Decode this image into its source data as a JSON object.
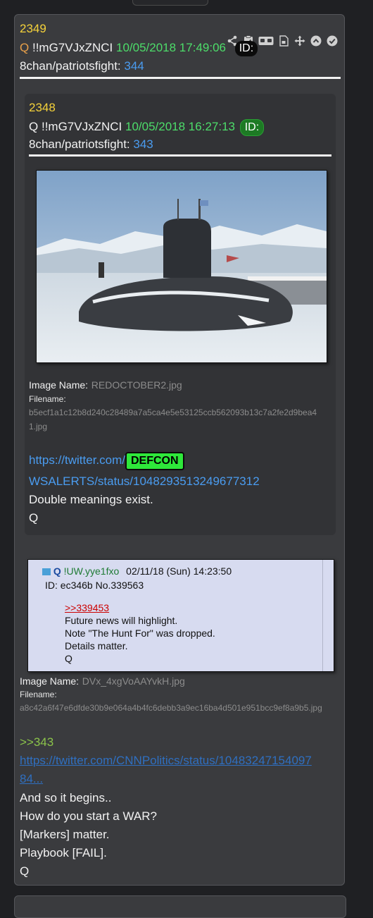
{
  "outer_post": {
    "number": "2349",
    "author_q": "Q",
    "tripcode": "!!mG7VJxZNCI",
    "date": "10/05/2018 17:49:06",
    "id_label": "ID:",
    "board": "8chan/patriotsfight:",
    "board_num": "344",
    "icons": [
      "share-icon",
      "clipboard-check-icon",
      "vr-glasses-icon",
      "file-icon",
      "move-icon",
      "chevron-up-icon",
      "check-icon"
    ]
  },
  "inner_post": {
    "number": "2348",
    "author_q": "Q",
    "tripcode": "!!mG7VJxZNCI",
    "date": "10/05/2018 16:27:13",
    "id_label": "ID:",
    "board": "8chan/patriotsfight:",
    "board_num": "343",
    "image_name_label": "Image Name:",
    "image_name": "REDOCTOBER2.jpg",
    "filename_label": "Filename:",
    "filename_line1": "b5ecf1a1c12b8d240c28489a7a5ca4e5e53125ccb562093b13c7a2fe2d9bea4",
    "filename_line2": "1.jpg",
    "link_part1": "https://twitter.com/",
    "defcon_badge": "DEFCON",
    "link_part2": "WSALERTS/status/1048293513249677312",
    "text_lines": [
      "Double meanings exist.",
      "Q"
    ]
  },
  "screenshot": {
    "header_q": "Q",
    "header_trip": "!UW.yye1fxo",
    "header_date": "02/11/18 (Sun) 14:23:50",
    "id_line": "ID: ec346b No.339563",
    "reply_link": ">>339453",
    "lines": [
      "Future news will highlight.",
      "Note \"The Hunt For\" was dropped.",
      "Details matter.",
      "Q"
    ]
  },
  "outer_body": {
    "image_name_label": "Image Name:",
    "image_name": "DVx_4xgVoAAYvkH.jpg",
    "filename_label": "Filename:",
    "filename": "a8c42a6f47e6dfde30b9e064a4b4fc6debb3a9ec16ba4d501e951bcc9ef8a9b5.jpg",
    "greentext": ">>343",
    "link_line1": "https://twitter.com/CNNPolitics/status/10483247154097",
    "link_line2": "84...",
    "text_lines": [
      "And so it begins..",
      "How do you start a WAR?",
      "[Markers] matter.",
      "Playbook [FAIL].",
      "Q"
    ]
  },
  "colors": {
    "post_number": "#f5d23a",
    "date": "#4ddd6a",
    "link": "#4a9cf0",
    "defcon": "#2ee83a",
    "greentext": "#8bc34a"
  }
}
